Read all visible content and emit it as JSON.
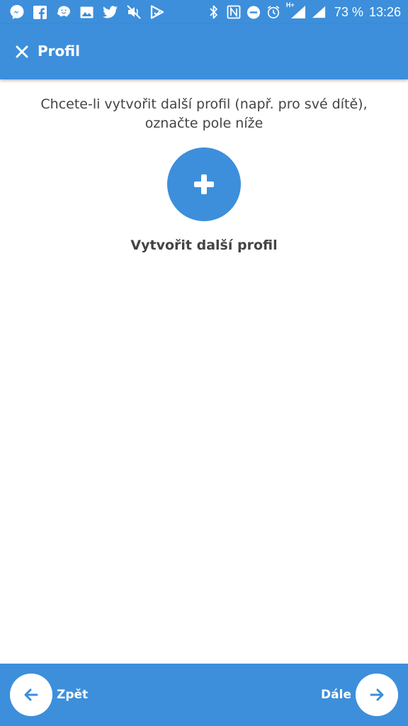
{
  "status_bar": {
    "notification_icons": [
      "messenger-icon",
      "facebook-icon",
      "waze-icon",
      "gallery-icon",
      "twitter-icon",
      "muted-icon",
      "play-icon"
    ],
    "system_icons": [
      "bluetooth-icon",
      "nfc-icon",
      "do-not-disturb-icon",
      "alarm-icon",
      "signal-icon",
      "signal-icon"
    ],
    "network_type": "H+",
    "battery": "73 %",
    "time": "13:26"
  },
  "app_bar": {
    "title": "Profil",
    "close_icon": "close-icon"
  },
  "content": {
    "intro_text": "Chcete-li vytvořit další profil (např. pro své dítě), označte pole níže",
    "add_button_icon": "plus-icon",
    "add_label": "Vytvořit další profil"
  },
  "bottom_bar": {
    "back_label": "Zpět",
    "next_label": "Dále"
  },
  "colors": {
    "primary": "#3d8fdb",
    "text": "#444444",
    "background": "#ffffff"
  }
}
